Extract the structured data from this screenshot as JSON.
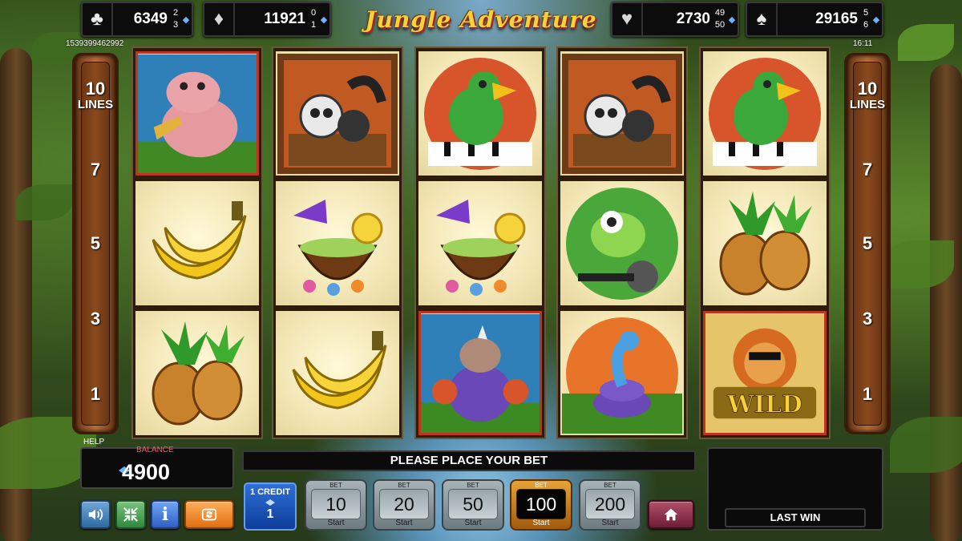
{
  "jackpots": [
    {
      "suit": "clubs",
      "symbol": "♣",
      "value": "6349",
      "side_top": "2",
      "side_bottom": "3"
    },
    {
      "suit": "diamonds",
      "symbol": "♦",
      "value": "11921",
      "side_top": "0",
      "side_bottom": "1"
    },
    {
      "suit": "hearts",
      "symbol": "♥",
      "value": "2730",
      "side_top": "49",
      "side_bottom": "50"
    },
    {
      "suit": "spades",
      "symbol": "♠",
      "value": "29165",
      "side_top": "5",
      "side_bottom": "6"
    }
  ],
  "logo": "Jungle Adventure",
  "session_id": "1539399462992",
  "clock": "16:11",
  "lines_panel": {
    "count": "10",
    "label": "LINES",
    "markers": [
      "7",
      "5",
      "3",
      "1"
    ]
  },
  "reels": [
    [
      "hippo-trumpet",
      "bananas",
      "pineapples"
    ],
    [
      "lemur-scatter",
      "coconut-cocktail",
      "bananas"
    ],
    [
      "parrot-piano",
      "coconut-cocktail",
      "rhino-maracas"
    ],
    [
      "lemur-scatter",
      "chameleon-microphone",
      "snake-cocktail"
    ],
    [
      "parrot-piano",
      "pineapples",
      "lion-wild"
    ]
  ],
  "winning_cells": [
    [
      0,
      0
    ],
    [
      2,
      2
    ],
    [
      4,
      2
    ]
  ],
  "help_label": "HELP",
  "balance": {
    "label": "BALANCE",
    "value": "4900"
  },
  "message": "PLEASE PLACE YOUR BET",
  "last_win": {
    "label": "LAST WIN",
    "value": ""
  },
  "credit": {
    "label": "1 CREDIT",
    "value": "1"
  },
  "bets": [
    {
      "top": "BET",
      "value": "10",
      "bottom": "Start",
      "selected": false
    },
    {
      "top": "BET",
      "value": "20",
      "bottom": "Start",
      "selected": false
    },
    {
      "top": "BET",
      "value": "50",
      "bottom": "Start",
      "selected": false
    },
    {
      "top": "BET",
      "value": "100",
      "bottom": "Start",
      "selected": true
    },
    {
      "top": "BET",
      "value": "200",
      "bottom": "Start",
      "selected": false
    }
  ],
  "icons": {
    "sound": "speaker-icon",
    "minimize": "minimize-icon",
    "info": "i",
    "autoplay": "autoplay-icon",
    "home": "home-icon"
  },
  "colors": {
    "accent_selected_bet": "#e8a23a",
    "credit_blue": "#2e6fd6",
    "win_frame": "#c0331d"
  }
}
